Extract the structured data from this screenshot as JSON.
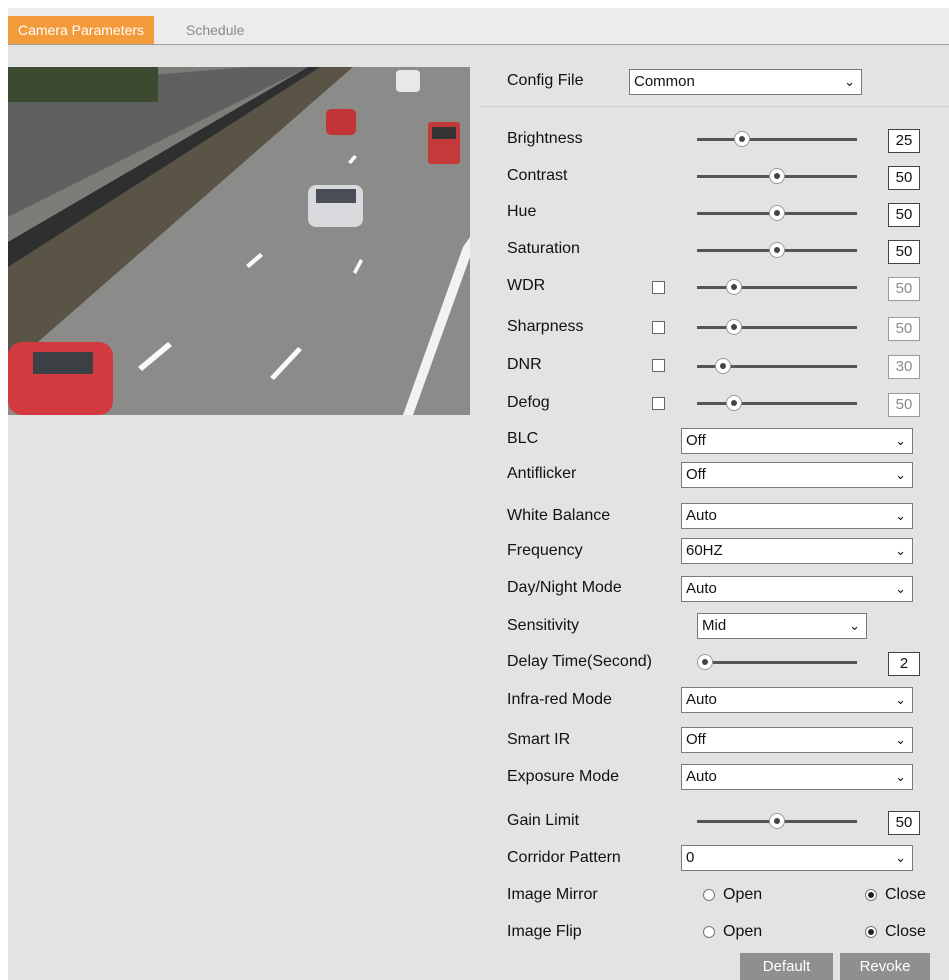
{
  "tabs": {
    "camera_parameters": "Camera Parameters",
    "schedule": "Schedule"
  },
  "config_file": {
    "label": "Config File",
    "value": "Common"
  },
  "sliders": {
    "brightness": {
      "label": "Brightness",
      "value": "25",
      "level": 0.28
    },
    "contrast": {
      "label": "Contrast",
      "value": "50",
      "level": 0.5
    },
    "hue": {
      "label": "Hue",
      "value": "50",
      "level": 0.5
    },
    "saturation": {
      "label": "Saturation",
      "value": "50",
      "level": 0.5
    },
    "wdr": {
      "label": "WDR",
      "value": "50",
      "level": 0.23
    },
    "sharpness": {
      "label": "Sharpness",
      "value": "50",
      "level": 0.23
    },
    "dnr": {
      "label": "DNR",
      "value": "30",
      "level": 0.16
    },
    "defog": {
      "label": "Defog",
      "value": "50",
      "level": 0.23
    },
    "delay_time": {
      "label": "Delay Time(Second)",
      "value": "2",
      "level": 0.05
    },
    "gain_limit": {
      "label": "Gain Limit",
      "value": "50",
      "level": 0.5
    }
  },
  "selects": {
    "blc": {
      "label": "BLC",
      "value": "Off"
    },
    "antiflicker": {
      "label": "Antiflicker",
      "value": "Off"
    },
    "white_balance": {
      "label": "White Balance",
      "value": "Auto"
    },
    "frequency": {
      "label": "Frequency",
      "value": "60HZ"
    },
    "day_night_mode": {
      "label": "Day/Night Mode",
      "value": "Auto"
    },
    "sensitivity": {
      "label": "Sensitivity",
      "value": "Mid"
    },
    "infrared_mode": {
      "label": "Infra-red Mode",
      "value": "Auto"
    },
    "smart_ir": {
      "label": "Smart IR",
      "value": "Off"
    },
    "exposure_mode": {
      "label": "Exposure Mode",
      "value": "Auto"
    },
    "corridor_pattern": {
      "label": "Corridor Pattern",
      "value": "0"
    }
  },
  "image_mirror": {
    "label": "Image Mirror",
    "open": "Open",
    "close": "Close",
    "selected": "Close"
  },
  "image_flip": {
    "label": "Image Flip",
    "open": "Open",
    "close": "Close",
    "selected": "Close"
  },
  "buttons": {
    "default": "Default",
    "revoke": "Revoke"
  },
  "colors": {
    "active_tab": "#f39a3a",
    "panel_bg": "#e3e3e3",
    "button_bg": "#8f8f8f"
  }
}
